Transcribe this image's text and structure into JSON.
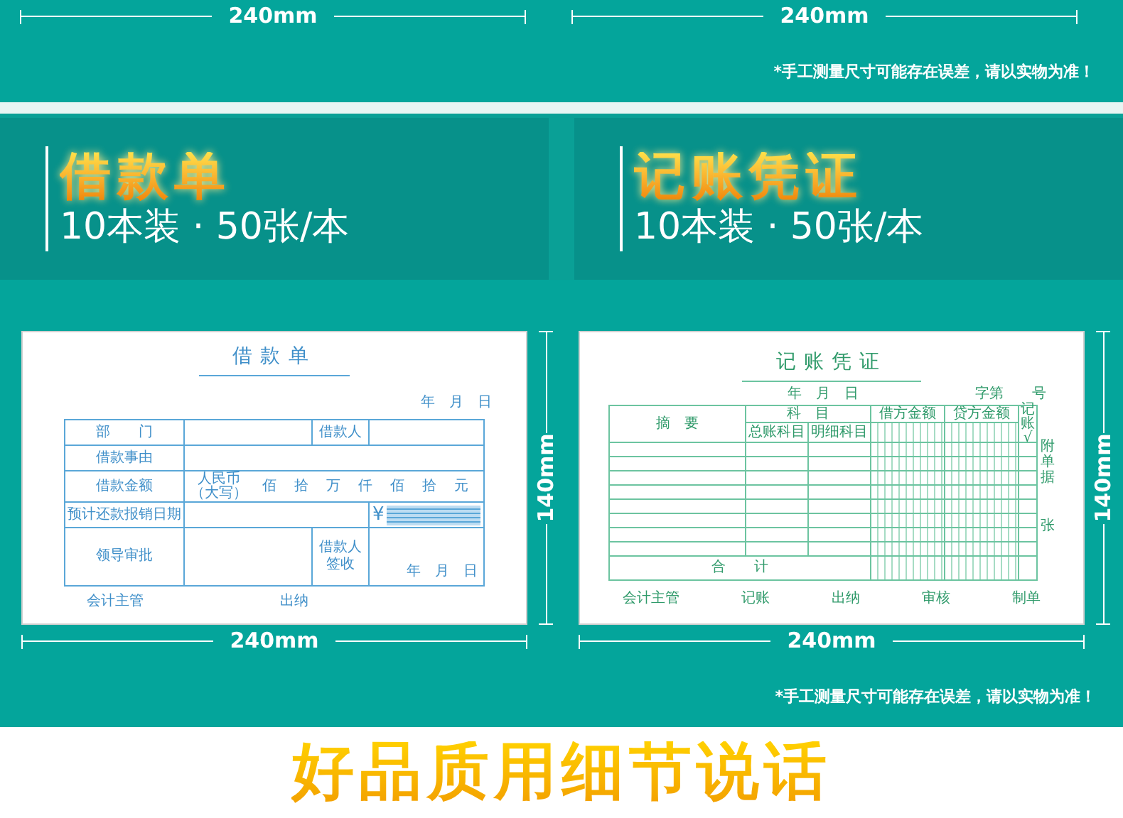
{
  "top_dimensions": [
    {
      "label": "240mm"
    },
    {
      "label": "240mm"
    }
  ],
  "top_note": "*手工测量尺寸可能存在误差，请以实物为准！",
  "products": [
    {
      "title": "借款单",
      "subtitle": "10本装 · 50张/本",
      "height_label": "140mm",
      "width_label": "240mm",
      "form": {
        "kind": "loan_slip",
        "title": "借款单",
        "date": "年　月　日",
        "dept_label": "部　　门",
        "borrower_label": "借款人",
        "reason_label": "借款事由",
        "amount_label": "借款金额",
        "currency": "人民币",
        "currency_note": "（大写）",
        "units": [
          "佰",
          "拾",
          "万",
          "仟",
          "佰",
          "拾",
          "元"
        ],
        "yuan_sign": "¥",
        "repay_label": "预计还款报销日期",
        "approval_label": "领导审批",
        "sign_label": "借款人签收",
        "sign_date": "年　月　日",
        "footer": [
          "会计主管",
          "出纳"
        ]
      }
    },
    {
      "title": "记账凭证",
      "subtitle": "10本装 · 50张/本",
      "height_label": "140mm",
      "width_label": "240mm",
      "form": {
        "kind": "voucher",
        "title": "记账凭证",
        "date": "年　月　日",
        "number": "字第　　号",
        "summary_label": "摘　要",
        "account_label": "科　目",
        "general_label": "总账科目",
        "detail_label": "明细科目",
        "debit_label": "借方金额",
        "credit_label": "贷方金额",
        "posted_label": "记账",
        "posted_mark": "√",
        "total_label": "合　　计",
        "attach_label": "附单据",
        "attach_unit": "张",
        "footer": [
          "会计主管",
          "记账",
          "出纳",
          "审核",
          "制单"
        ]
      }
    }
  ],
  "bottom_note": "*手工测量尺寸可能存在误差，请以实物为准！",
  "section_heading": "好品质用细节说话"
}
